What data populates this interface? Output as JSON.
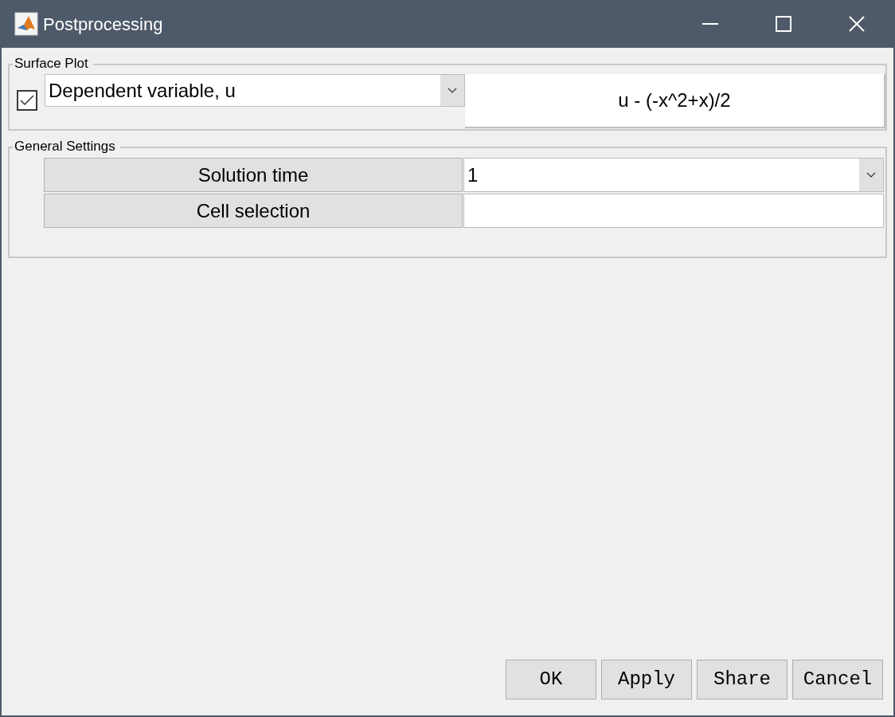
{
  "window": {
    "title": "Postprocessing"
  },
  "surface_plot": {
    "title": "Surface Plot",
    "checked": true,
    "variable": "Dependent variable, u",
    "expression": "u - (-x^2+x)/2"
  },
  "general_settings": {
    "title": "General Settings",
    "rows": [
      {
        "label": "Solution time",
        "kind": "dropdown",
        "value": "1"
      },
      {
        "label": "Cell selection",
        "kind": "text",
        "value": ""
      }
    ]
  },
  "buttons": [
    "OK",
    "Apply",
    "Share",
    "Cancel"
  ]
}
